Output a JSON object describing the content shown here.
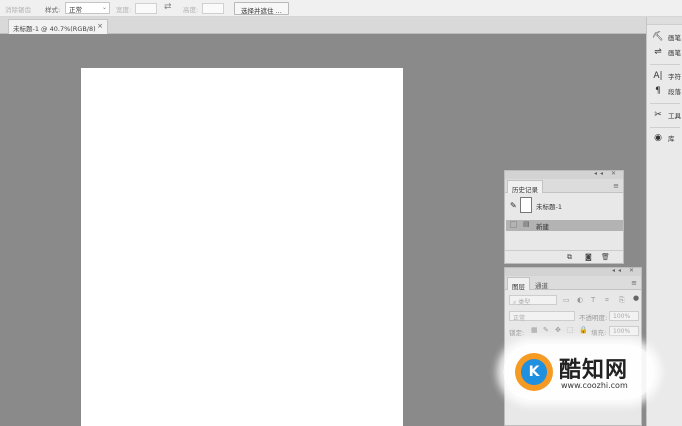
{
  "options_bar": {
    "blur_label": "消除锯齿",
    "style_label": "样式:",
    "style_value": "正常",
    "width_label": "宽度:",
    "swap_icon": "swap-arrows-icon",
    "height_label": "高度:",
    "select_mask_button": "选择并遮住 ..."
  },
  "document_tab": {
    "title": "未标题-1 @ 40.7%(RGB/8)",
    "close": "×"
  },
  "right_dock": {
    "items": [
      {
        "icon": "brush-icon",
        "label": "画笔"
      },
      {
        "icon": "brush-settings-icon",
        "label": "画笔"
      },
      {
        "icon": "character-icon",
        "label": "字符"
      },
      {
        "icon": "paragraph-icon",
        "label": "段落"
      },
      {
        "icon": "tools-icon",
        "label": "工具"
      },
      {
        "icon": "libraries-icon",
        "label": "库"
      }
    ]
  },
  "history_panel": {
    "tab": "历史记录",
    "snapshot_label": "未标题-1",
    "state_label": "新建"
  },
  "layers_panel": {
    "tabs": [
      "图层",
      "通道"
    ],
    "kind_filter": "类型",
    "blend_mode": "正常",
    "opacity_label": "不透明度:",
    "opacity_value": "100%",
    "lock_label": "锁定:",
    "fill_label": "填充:",
    "fill_value": "100%"
  },
  "watermark": {
    "brand": "酷知网",
    "url": "www.coozhi.com",
    "logo_letter": "K"
  }
}
